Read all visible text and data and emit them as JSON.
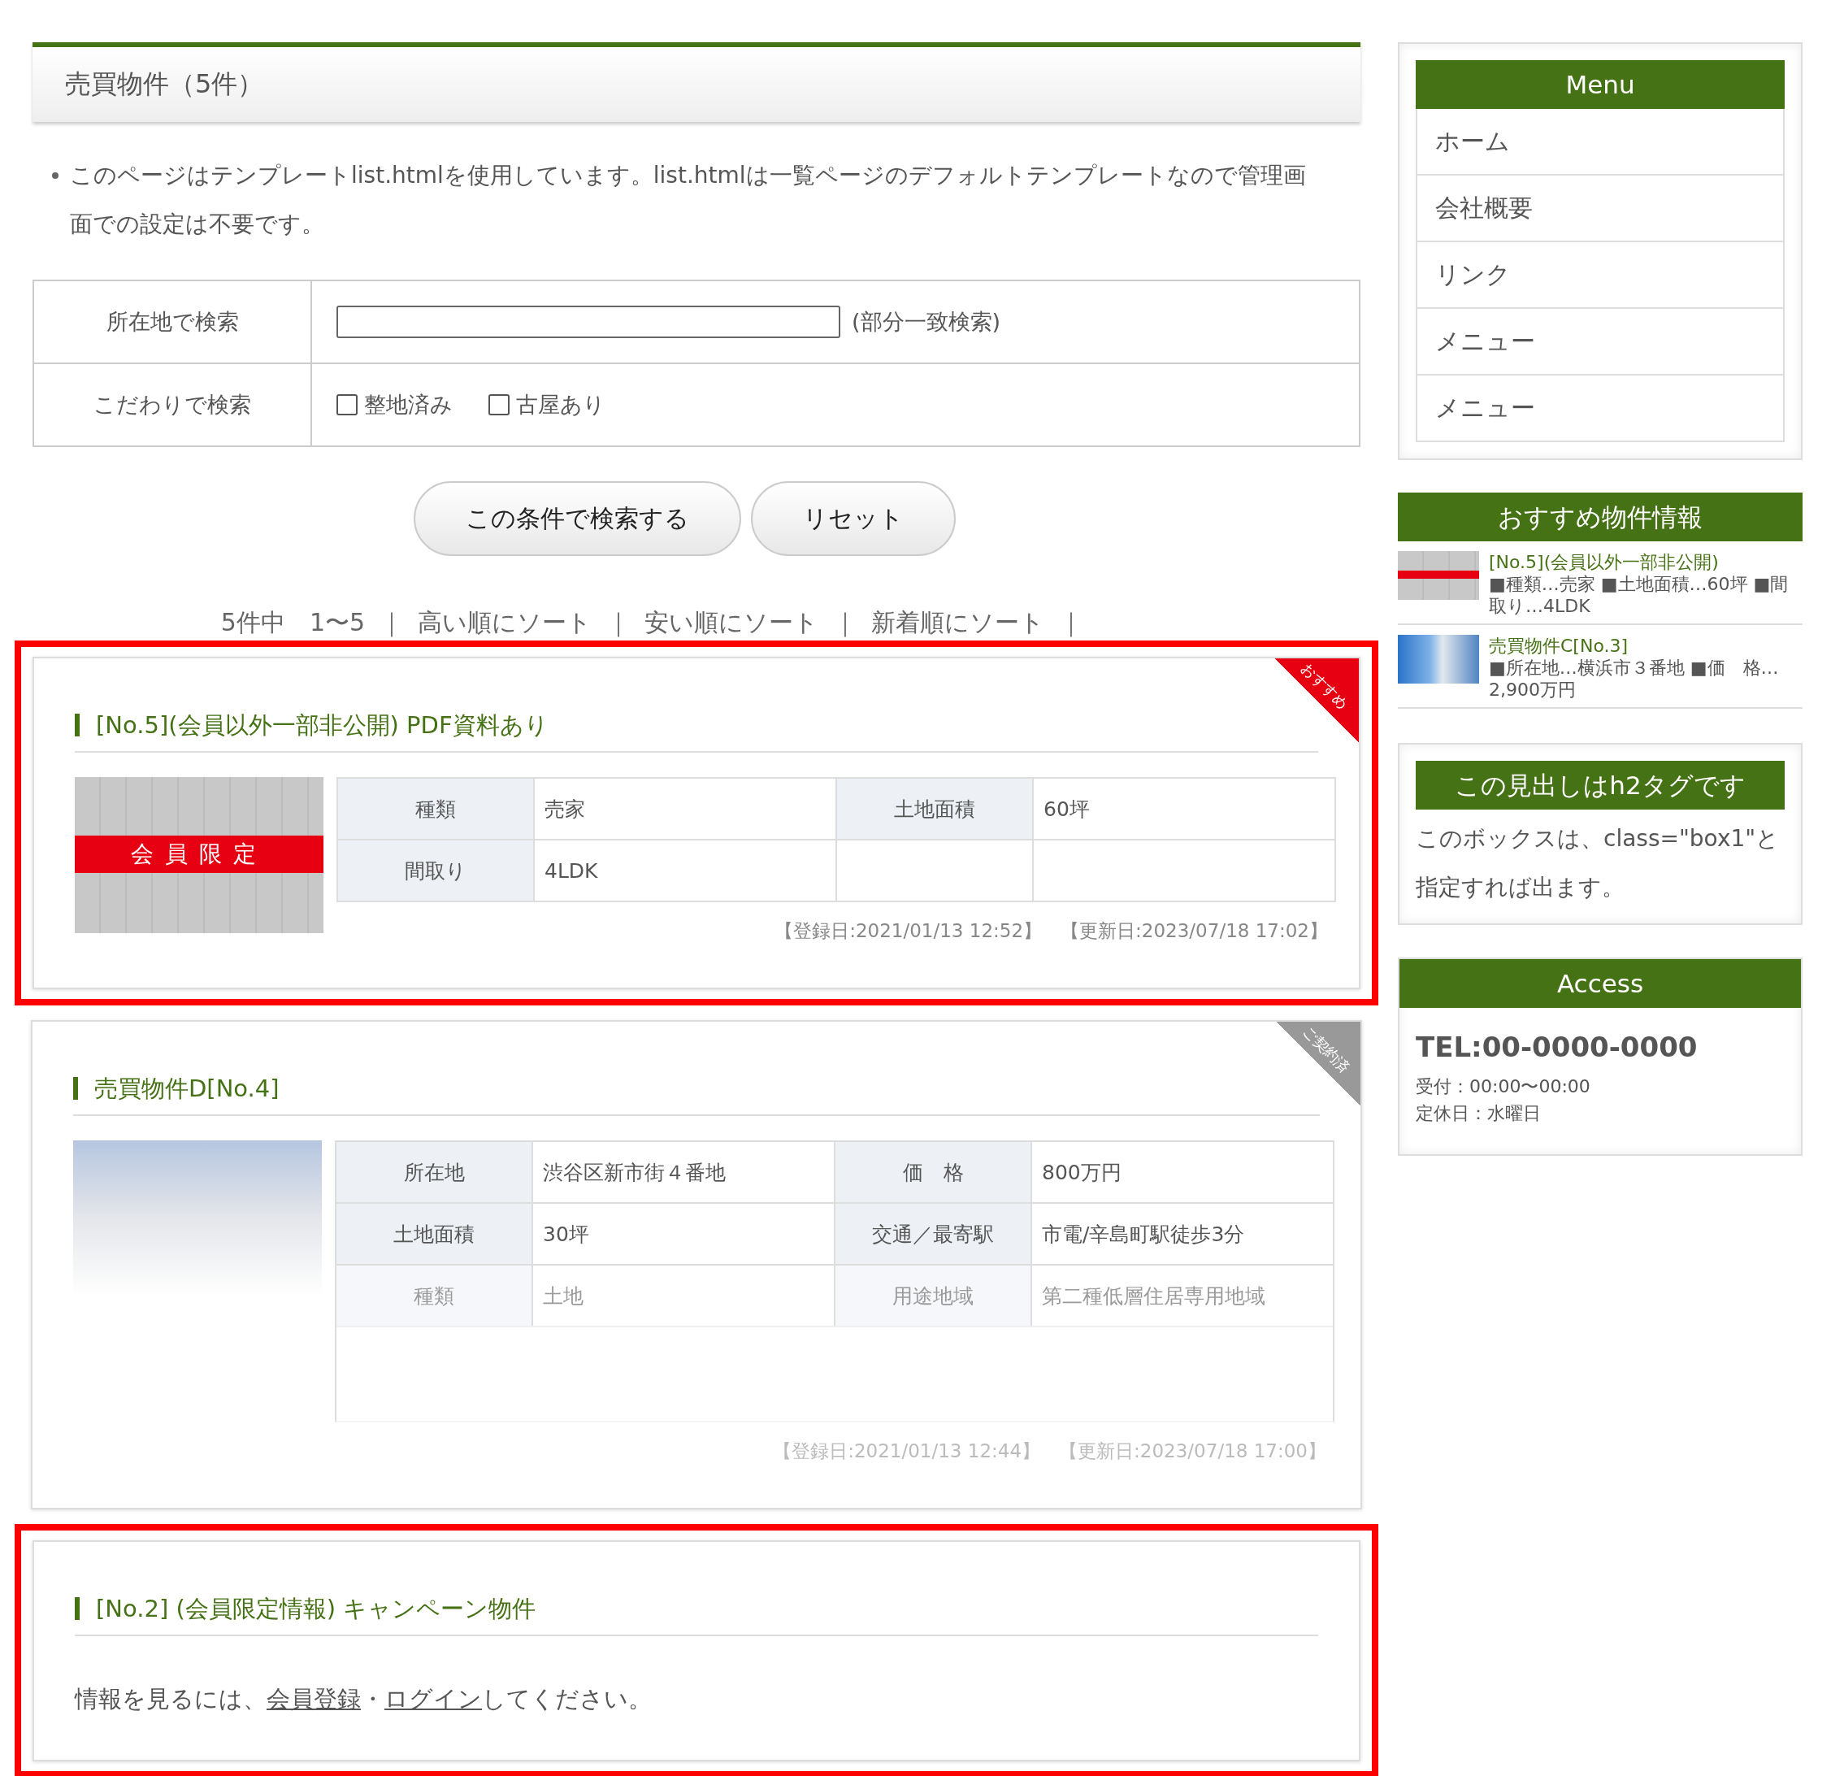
{
  "page_title": "売買物件（5件）",
  "notes": [
    "このページはテンプレートlist.htmlを使用しています。list.htmlは一覧ページのデフォルトテンプレートなので管理画面での設定は不要です。"
  ],
  "search_form": {
    "rows": [
      {
        "kind": "text",
        "label": "所在地で検索",
        "placeholder_note": "(部分一致検索)"
      },
      {
        "kind": "checkboxes",
        "label": "こだわりで検索",
        "options": [
          {
            "label": "整地済み",
            "checked": false
          },
          {
            "label": "古屋あり",
            "checked": false
          }
        ]
      }
    ],
    "buttons": [
      {
        "label": "この条件で検索する"
      },
      {
        "label": "リセット"
      }
    ]
  },
  "sort_bar": {
    "summary": "5件中　1〜5",
    "separator": "｜",
    "links": [
      "高い順にソート",
      "安い順にソート",
      "新着順にソート"
    ]
  },
  "listings": [
    {
      "kind": "details",
      "highlighted": true,
      "ribbon": {
        "label": "おすすめ",
        "color": "#e60012"
      },
      "title": "[No.5](会員以外一部非公開) PDF資料あり",
      "photo": {
        "kind": "floorplan",
        "badge": "会員限定"
      },
      "rows": [
        {
          "faded": false,
          "cells": [
            {
              "label": "種類",
              "value": "売家"
            },
            {
              "label": "土地面積",
              "value": "60坪"
            }
          ]
        },
        {
          "faded": false,
          "cells": [
            {
              "label": "間取り",
              "value": "4LDK"
            }
          ]
        }
      ],
      "dates": "【登録日:2021/01/13 12:52】　【更新日:2023/07/18 17:02】"
    },
    {
      "kind": "details",
      "highlighted": false,
      "fade": true,
      "ribbon": {
        "label": "ご契約済",
        "color": "#999999"
      },
      "title": "売買物件D[No.4]",
      "photo": {
        "kind": "building"
      },
      "rows": [
        {
          "faded": false,
          "cells": [
            {
              "label": "所在地",
              "value": "渋谷区新市街４番地"
            },
            {
              "label": "価　格",
              "value": "800万円"
            }
          ]
        },
        {
          "faded": false,
          "cells": [
            {
              "label": "土地面積",
              "value": "30坪"
            },
            {
              "label": "交通／最寄駅",
              "value": "市電/辛島町駅徒歩3分"
            }
          ]
        },
        {
          "faded": true,
          "cells": [
            {
              "label": "種類",
              "value": "土地"
            },
            {
              "label": "用途地域",
              "value": "第二種低層住居専用地域"
            }
          ]
        }
      ],
      "dates": "【登録日:2021/01/13 12:44】　【更新日:2023/07/18 17:00】"
    },
    {
      "kind": "locked",
      "highlighted": true,
      "title": "[No.2] (会員限定情報) キャンペーン物件",
      "message": [
        "情報を見るには、",
        "会員登録",
        "・",
        "ログイン",
        "してください。"
      ]
    }
  ],
  "sidebar": {
    "menu": {
      "title": "Menu",
      "items": [
        "ホーム",
        "会社概要",
        "リンク",
        "メニュー",
        "メニュー"
      ]
    },
    "featured": {
      "title": "おすすめ物件情報",
      "items": [
        {
          "photo": {
            "kind": "floorplan"
          },
          "title": "[No.5](会員以外一部非公開)",
          "text": "■種類…売家 ■土地面積…60坪 ■間取り…4LDK"
        },
        {
          "photo": {
            "kind": "tower"
          },
          "title": "売買物件C[No.3]",
          "text": "■所在地…横浜市３番地 ■価　格…2,900万円"
        }
      ]
    },
    "box": {
      "title": "この見出しはh2タグです",
      "text": "このボックスは、class=\"box1\"と指定すれば出ます。"
    },
    "access": {
      "title": "Access",
      "tel": "TEL:00-0000-0000",
      "lines": [
        "受付：00:00〜00:00",
        "定休日：水曜日"
      ]
    }
  }
}
